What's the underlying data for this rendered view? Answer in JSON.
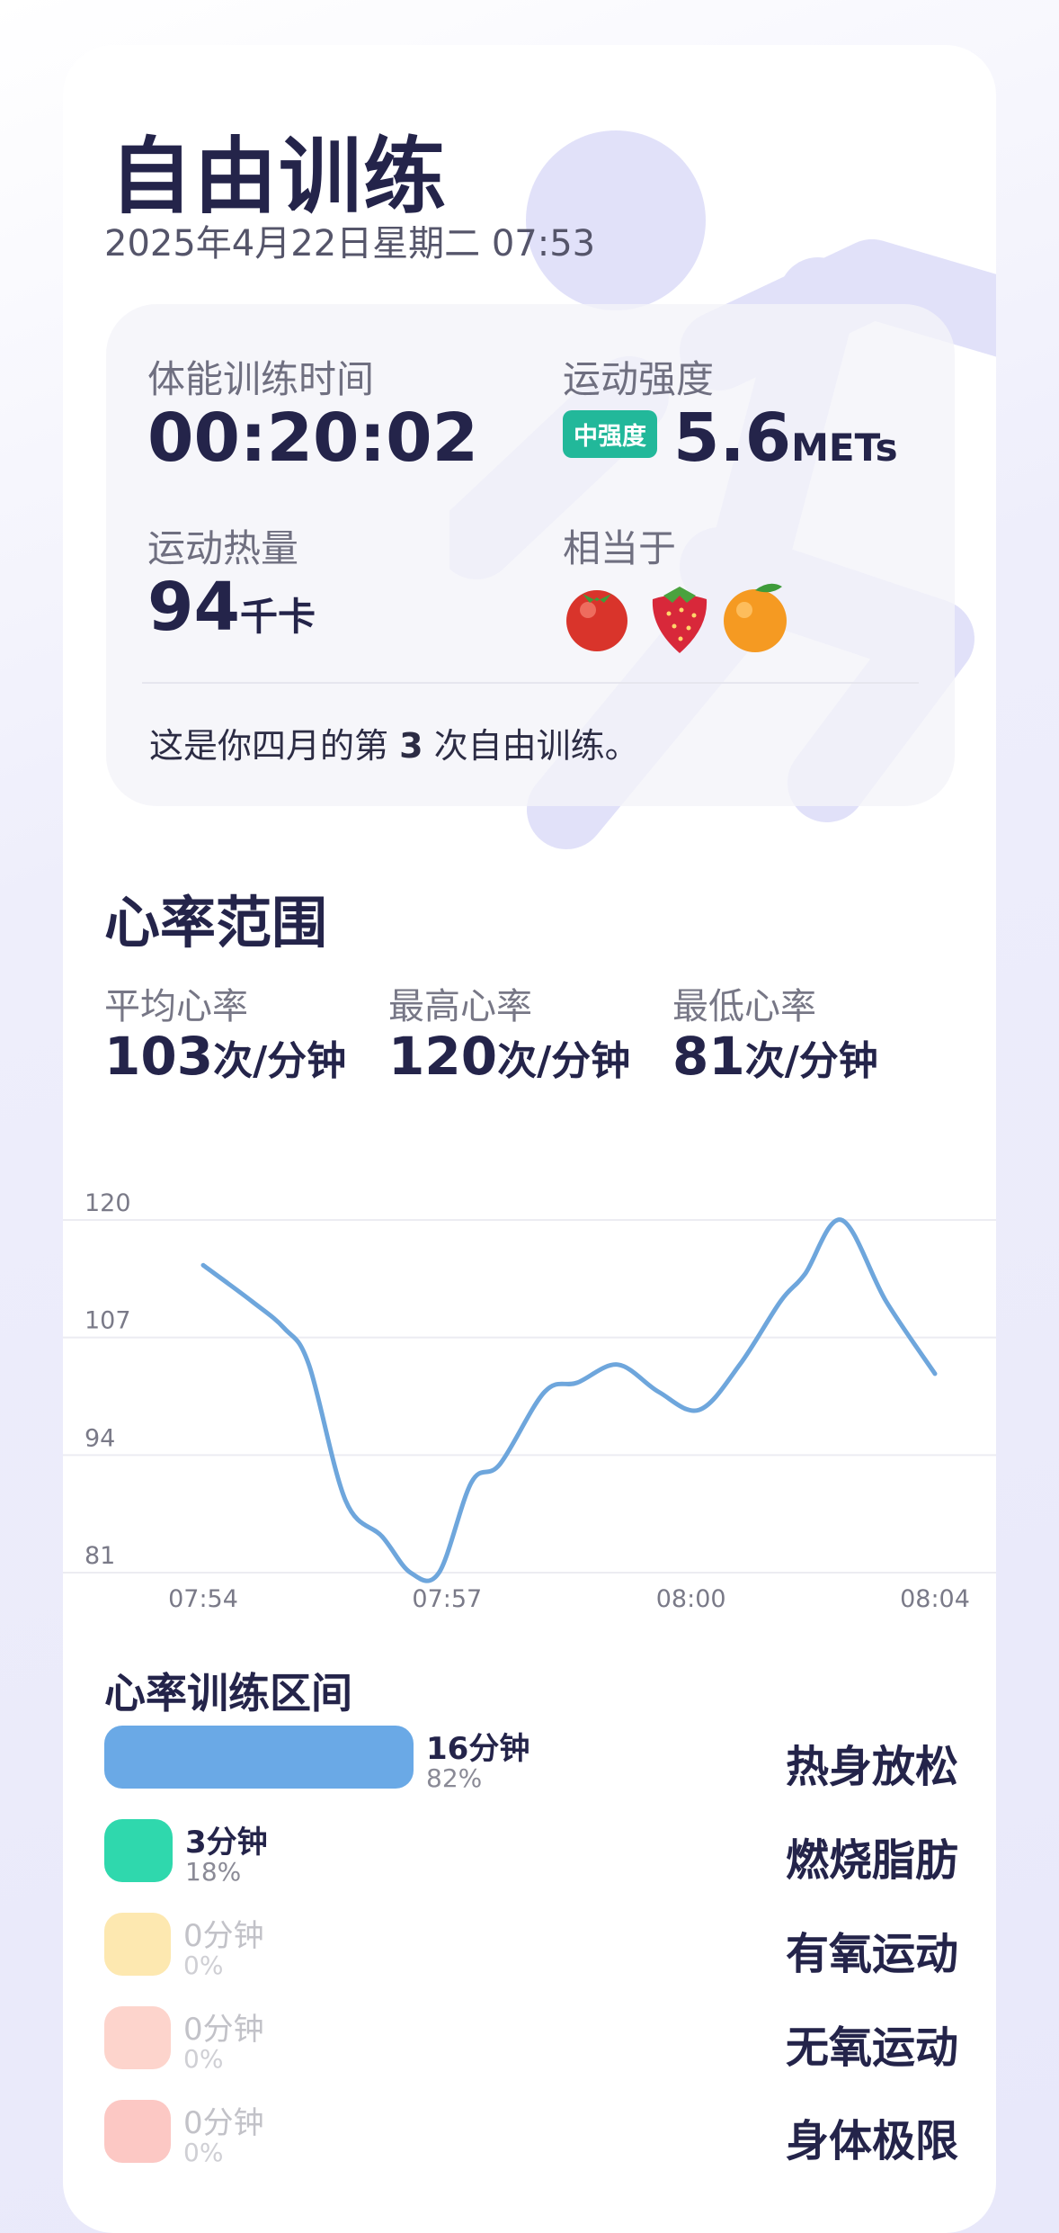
{
  "workout": {
    "title": "自由训练",
    "datetime": "2025年4月22日星期二 07:53"
  },
  "summary": {
    "training_time_label": "体能训练时间",
    "training_time_value": "00:20:02",
    "intensity_label": "运动强度",
    "intensity_badge": "中强度",
    "intensity_value": "5.6",
    "intensity_unit": "METs",
    "calories_label": "运动热量",
    "calories_value": "94",
    "calories_unit": "千卡",
    "equivalent_label": "相当于",
    "equivalent_items": [
      "tomato-icon",
      "strawberry-icon",
      "orange-icon"
    ],
    "month_prefix": "这是你四月的第 ",
    "month_count": "3",
    "month_suffix": " 次自由训练。"
  },
  "heart_rate": {
    "section_title": "心率范围",
    "avg_label": "平均心率",
    "avg_value": "103",
    "max_label": "最高心率",
    "max_value": "120",
    "min_label": "最低心率",
    "min_value": "81",
    "unit": "次/分钟"
  },
  "chart_data": {
    "type": "line",
    "title": "",
    "xlabel": "",
    "ylabel": "",
    "y_ticks": [
      81,
      94,
      107,
      120
    ],
    "ylim": [
      81,
      120
    ],
    "x_tick_labels": [
      "07:54",
      "07:57",
      "08:00",
      "08:04"
    ],
    "x_tick_minutes": [
      0,
      3,
      6,
      9
    ],
    "grid": true,
    "line_color": "#6ea6dc",
    "points_minutes": [
      0,
      0.6,
      1.0,
      1.3,
      1.75,
      2.2,
      2.55,
      2.9,
      3.3,
      3.65,
      4.2,
      4.6,
      5.1,
      5.6,
      6.1,
      6.6,
      7.1,
      7.4,
      7.85,
      8.4,
      9.0
    ],
    "points_bpm": [
      115,
      111,
      108,
      104,
      89,
      85,
      81,
      81,
      91,
      93,
      101,
      102,
      104,
      101,
      99,
      104,
      111,
      114,
      120,
      111,
      103
    ]
  },
  "zones": {
    "title": "心率训练区间",
    "items": [
      {
        "name": "热身放松",
        "duration": "16分钟",
        "percent": "82%",
        "share": 0.82,
        "color": "#6aa9e6"
      },
      {
        "name": "燃烧脂肪",
        "duration": "3分钟",
        "percent": "18%",
        "share": 0.18,
        "color": "#2fd8ad"
      },
      {
        "name": "有氧运动",
        "duration": "0分钟",
        "percent": "0%",
        "share": 0,
        "color": "#fde8b0"
      },
      {
        "name": "无氧运动",
        "duration": "0分钟",
        "percent": "0%",
        "share": 0,
        "color": "#fdd4cc"
      },
      {
        "name": "身体极限",
        "duration": "0分钟",
        "percent": "0%",
        "share": 0,
        "color": "#fcc8c4"
      }
    ]
  }
}
